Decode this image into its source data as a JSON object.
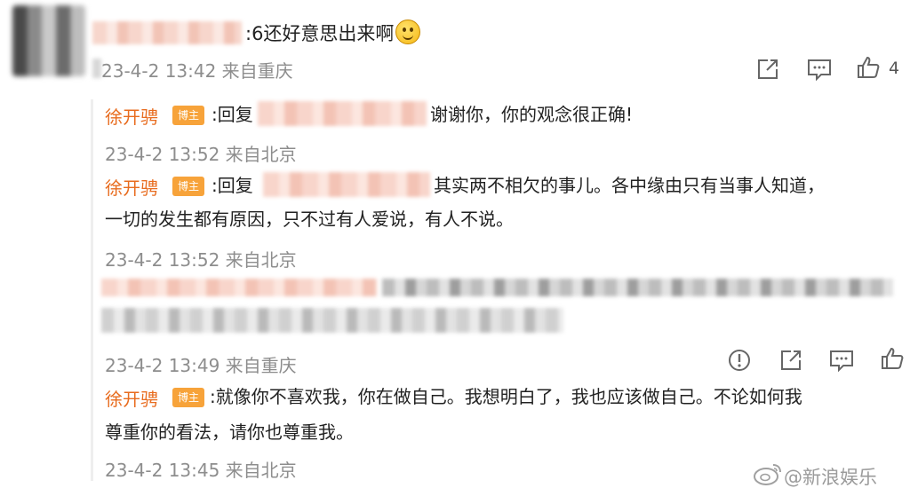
{
  "top_comment": {
    "text": ":6还好意思出来啊",
    "meta": "23-4-2 13:42 来自重庆",
    "like_count": "4"
  },
  "replies": [
    {
      "author": "徐开骋",
      "badge": "博主",
      "prefix": ":回复",
      "text": "谢谢你，你的观念很正确!",
      "meta": "23-4-2 13:52 来自北京"
    },
    {
      "author": "徐开骋",
      "badge": "博主",
      "prefix": ":回复",
      "text_line1": "其实两不相欠的事儿。各中缘由只有当事人知道，",
      "text_line2": "一切的发生都有原因，只不过有人爱说，有人不说。",
      "meta": "23-4-2 13:52 来自北京"
    },
    {
      "meta": "23-4-2 13:49 来自重庆"
    },
    {
      "author": "徐开骋",
      "badge": "博主",
      "text_line1": ":就像你不喜欢我，你在做自己。我想明白了，我也应该做自己。不论如何我",
      "text_line2": "尊重你的看法，请你也尊重我。",
      "meta": "23-4-2 13:45 来自北京"
    }
  ],
  "watermark": "@新浪娱乐",
  "icons": [
    "share-icon",
    "comment-icon",
    "like-icon",
    "report-icon",
    "weibo-logo-icon"
  ]
}
